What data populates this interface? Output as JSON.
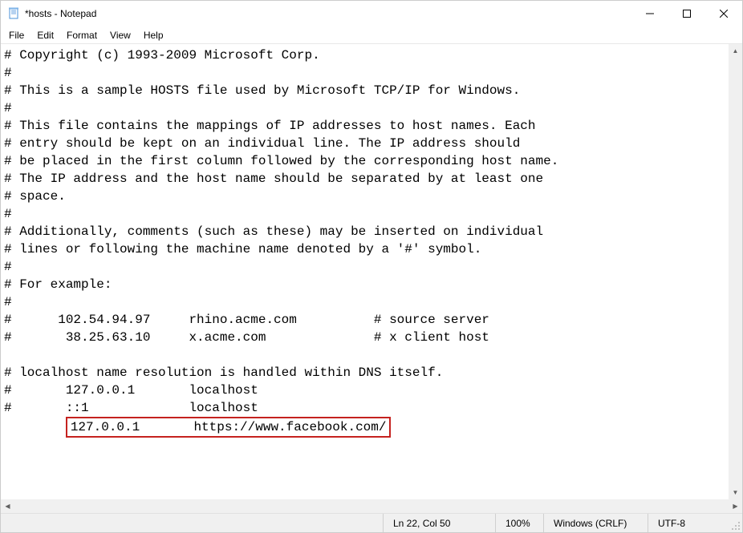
{
  "titlebar": {
    "title": "*hosts - Notepad"
  },
  "menu": {
    "file": "File",
    "edit": "Edit",
    "format": "Format",
    "view": "View",
    "help": "Help"
  },
  "content": {
    "lines": [
      "# Copyright (c) 1993-2009 Microsoft Corp.",
      "#",
      "# This is a sample HOSTS file used by Microsoft TCP/IP for Windows.",
      "#",
      "# This file contains the mappings of IP addresses to host names. Each",
      "# entry should be kept on an individual line. The IP address should",
      "# be placed in the first column followed by the corresponding host name.",
      "# The IP address and the host name should be separated by at least one",
      "# space.",
      "#",
      "# Additionally, comments (such as these) may be inserted on individual",
      "# lines or following the machine name denoted by a '#' symbol.",
      "#",
      "# For example:",
      "#",
      "#      102.54.94.97     rhino.acme.com          # source server",
      "#       38.25.63.10     x.acme.com              # x client host",
      "",
      "# localhost name resolution is handled within DNS itself.",
      "#       127.0.0.1       localhost",
      "#       ::1             localhost"
    ],
    "highlighted_prefix": "        ",
    "highlighted": "127.0.0.1       https://www.facebook.com/"
  },
  "statusbar": {
    "position": "Ln 22, Col 50",
    "zoom": "100%",
    "line_ending": "Windows (CRLF)",
    "encoding": "UTF-8"
  }
}
